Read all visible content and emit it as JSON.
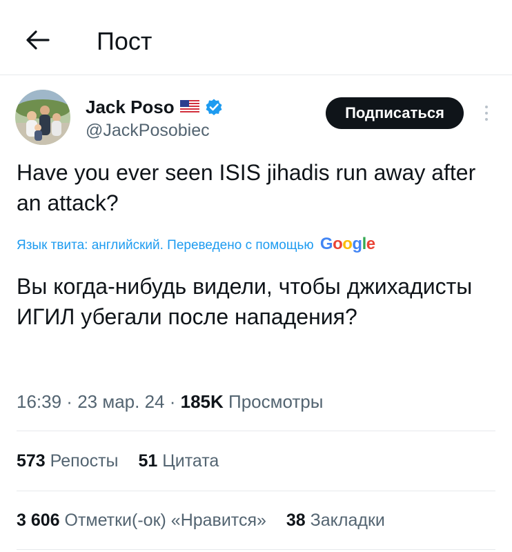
{
  "header": {
    "title": "Пост",
    "back_icon": "arrow-left-icon"
  },
  "author": {
    "name": "Jack Poso",
    "flag_icon": "us-flag-icon",
    "verified_icon": "verified-badge-icon",
    "handle": "@JackPosobiec",
    "follow_label": "Подписаться",
    "more_icon": "more-vertical-icon",
    "verified_color": "#1d9bf0"
  },
  "tweet": {
    "text": "Have you ever seen ISIS jihadis run away after an attack?",
    "translation_note": "Язык твита: английский. Переведено с помощью",
    "translation_provider": "Google",
    "translated_text": "Вы когда-нибудь видели, чтобы джихадисты ИГИЛ убегали после нападения?"
  },
  "meta": {
    "time": "16:39",
    "sep1": " · ",
    "date": "23 мар. 24",
    "sep2": " · ",
    "views": "185K",
    "views_label": "Просмотры"
  },
  "stats": {
    "reposts_count": "573",
    "reposts_label": "Репосты",
    "quotes_count": "51",
    "quotes_label": "Цитата",
    "likes_count": "3 606",
    "likes_label": "Отметки(-ок) «Нравится»",
    "bookmarks_count": "38",
    "bookmarks_label": "Закладки"
  }
}
